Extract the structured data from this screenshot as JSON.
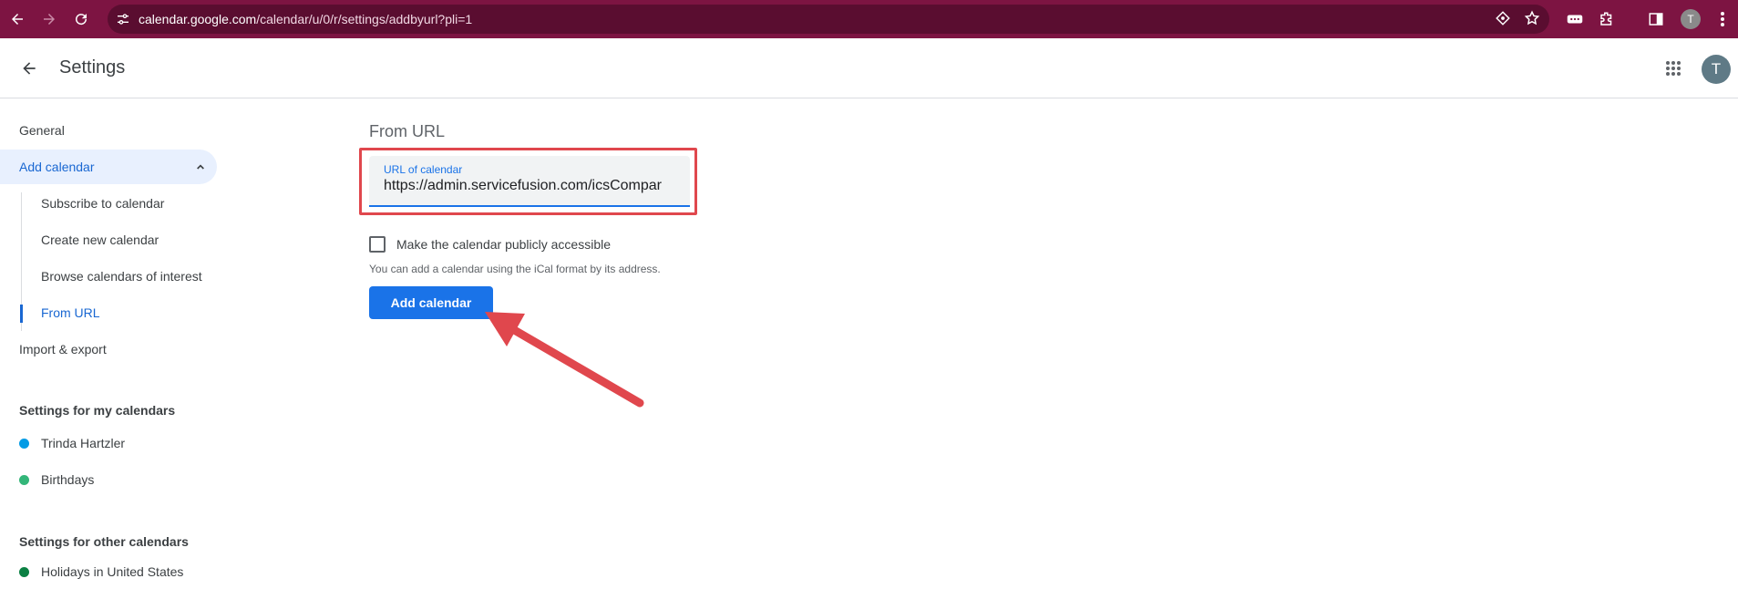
{
  "browser": {
    "url_host": "calendar.google.com",
    "url_path": "/calendar/u/0/r/settings/addbyurl?pli=1",
    "profile_initial": "T"
  },
  "header": {
    "title": "Settings",
    "account_initial": "T"
  },
  "sidebar": {
    "general": "General",
    "add_calendar": "Add calendar",
    "add_calendar_items": [
      "Subscribe to calendar",
      "Create new calendar",
      "Browse calendars of interest",
      "From URL"
    ],
    "import_export": "Import & export",
    "my_calendars_heading": "Settings for my calendars",
    "my_calendars": [
      {
        "name": "Trinda Hartzler",
        "color": "#039be5"
      },
      {
        "name": "Birthdays",
        "color": "#33b679"
      }
    ],
    "other_calendars_heading": "Settings for other calendars",
    "other_calendars": [
      {
        "name": "Holidays in United States",
        "color": "#0b8043"
      }
    ]
  },
  "main": {
    "section_title": "From URL",
    "url_label": "URL of calendar",
    "url_value": "https://admin.servicefusion.com/icsCompar",
    "public_checkbox_label": "Make the calendar publicly accessible",
    "public_checked": false,
    "helper_text": "You can add a calendar using the iCal format by its address.",
    "add_button": "Add calendar"
  },
  "colors": {
    "accent": "#1a73e8",
    "highlight": "#e0474d",
    "chrome": "#7d1442"
  }
}
